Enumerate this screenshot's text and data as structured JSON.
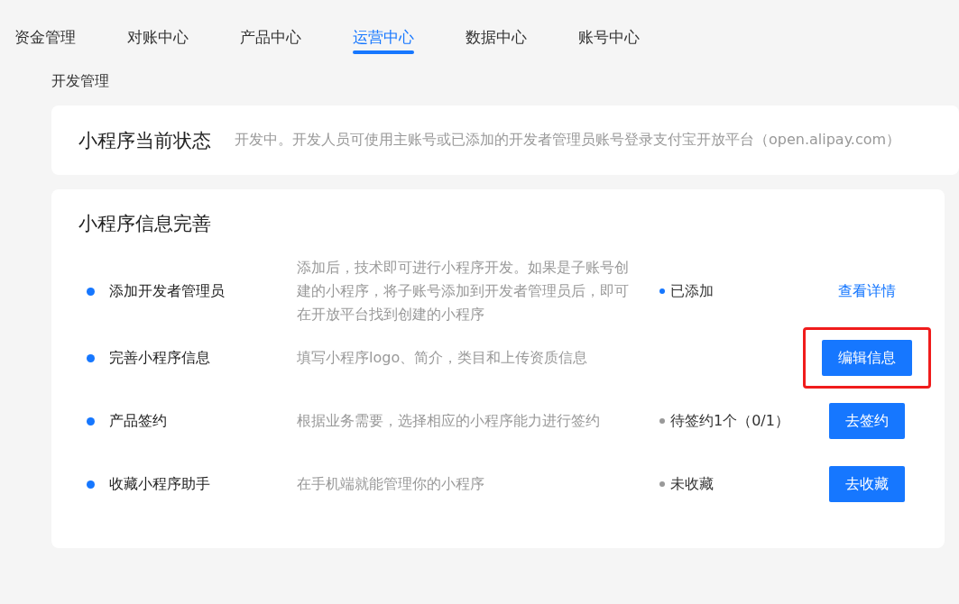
{
  "tabs": [
    {
      "label": "资金管理",
      "selected": false
    },
    {
      "label": "对账中心",
      "selected": false
    },
    {
      "label": "产品中心",
      "selected": false
    },
    {
      "label": "运营中心",
      "selected": true
    },
    {
      "label": "数据中心",
      "selected": false
    },
    {
      "label": "账号中心",
      "selected": false
    }
  ],
  "section_title": "开发管理",
  "status_card": {
    "title": "小程序当前状态",
    "text": "开发中。开发人员可使用主账号或已添加的开发者管理员账号登录支付宝开放平台（open.alipay.com）"
  },
  "info_card": {
    "title": "小程序信息完善",
    "rows": [
      {
        "name": "添加开发者管理员",
        "description": "添加后，技术即可进行小程序开发。如果是子账号创建的小程序，将子账号添加到开发者管理员后，即可在开放平台找到创建的小程序",
        "status": {
          "label": "已添加",
          "color": "#1677ff"
        },
        "action": {
          "kind": "link",
          "label": "查看详情"
        },
        "highlighted": false
      },
      {
        "name": "完善小程序信息",
        "description": "填写小程序logo、简介，类目和上传资质信息",
        "action": {
          "kind": "button",
          "label": "编辑信息"
        },
        "highlighted": true
      },
      {
        "name": "产品签约",
        "description": "根据业务需要，选择相应的小程序能力进行签约",
        "status": {
          "label": "待签约1个（0/1）",
          "color": "#999999"
        },
        "action": {
          "kind": "button",
          "label": "去签约"
        },
        "highlighted": false
      },
      {
        "name": "收藏小程序助手",
        "description": "在手机端就能管理你的小程序",
        "status": {
          "label": "未收藏",
          "color": "#999999"
        },
        "action": {
          "kind": "button",
          "label": "去收藏"
        },
        "highlighted": false
      }
    ]
  }
}
